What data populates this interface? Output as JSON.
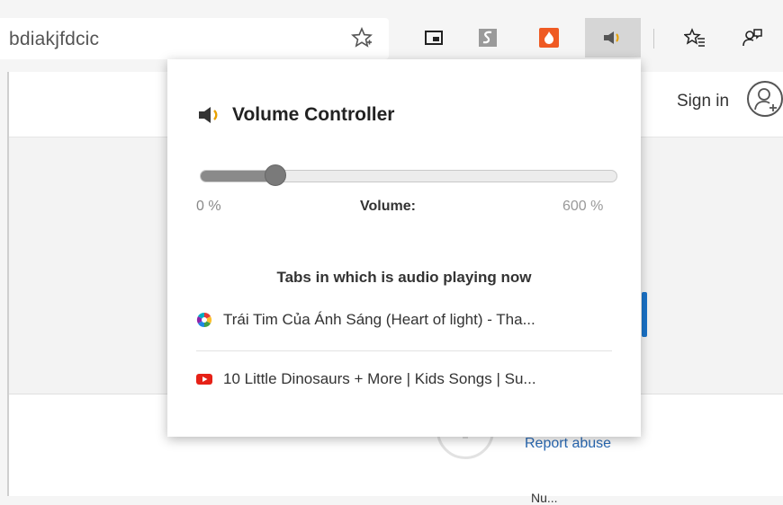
{
  "browser": {
    "address_text": "bdiakjfdcic",
    "star_icon": "favorite-star-icon",
    "extensions": [
      {
        "name": "picture-in-picture-icon"
      },
      {
        "name": "extension-s-icon"
      },
      {
        "name": "extension-fire-icon"
      },
      {
        "name": "volume-speaker-icon"
      }
    ],
    "favorites_icon": "favorites-list-icon",
    "feedback_icon": "feedback-icon"
  },
  "page": {
    "sign_in": "Sign in",
    "report_abuse": "Report abuse",
    "bottom_text": "Nu..."
  },
  "popup": {
    "title": "Volume Controller",
    "volume": {
      "min_label": "0 %",
      "label": "Volume:",
      "max_label": "600 %",
      "value_fraction": 0.18
    },
    "tabs_heading": "Tabs in which is audio playing now",
    "tabs": [
      {
        "title": "Trái Tim Của Ánh Sáng (Heart of light) - Tha...",
        "icon": "colorful-circle-icon"
      },
      {
        "title": "10 Little Dinosaurs + More | Kids Songs | Su...",
        "icon": "youtube-icon"
      }
    ]
  },
  "colors": {
    "accent_blue": "#1a73c9",
    "youtube_red": "#e62117",
    "fire_orange": "#ef5a23"
  }
}
